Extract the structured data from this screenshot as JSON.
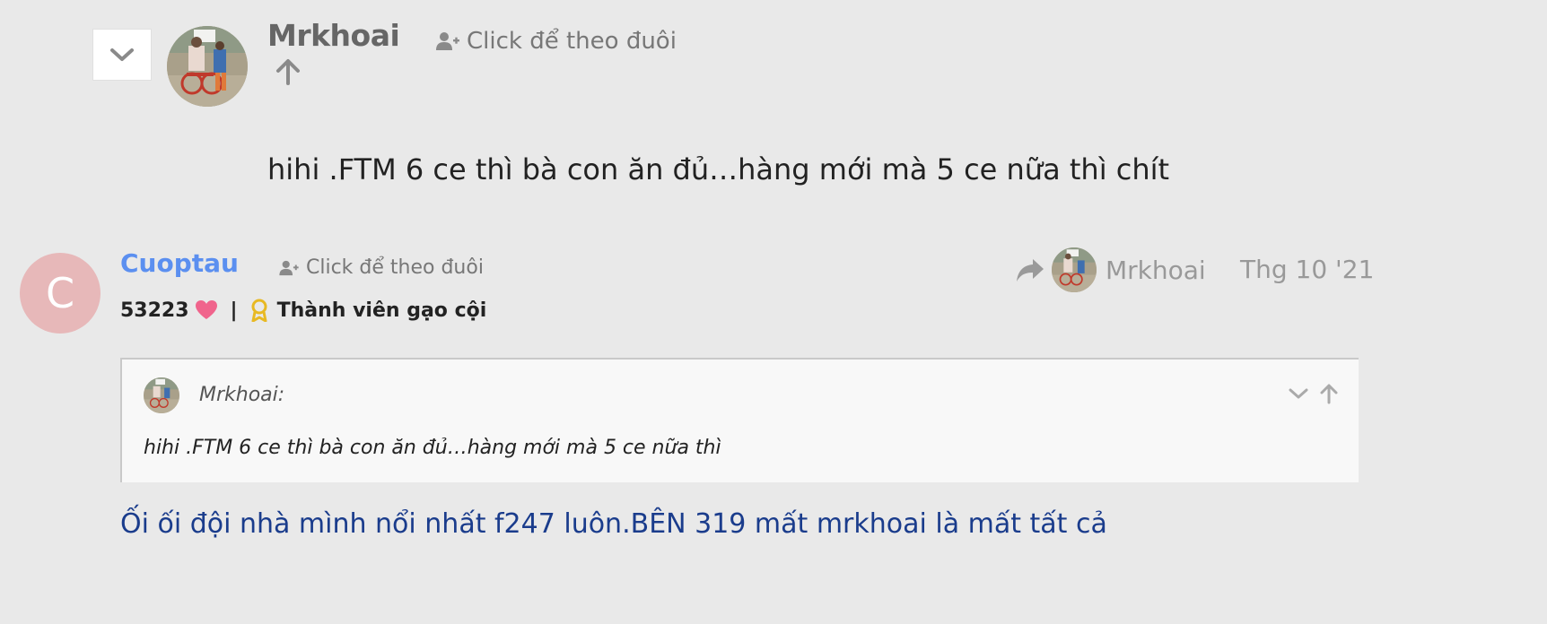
{
  "parent_post": {
    "author": "Mrkhoai",
    "follow_label": "Click để theo đuôi",
    "text": "hihi .FTM 6 ce thì bà con ăn đủ…hàng mới mà 5 ce nữa thì chít"
  },
  "reply": {
    "avatar_letter": "C",
    "avatar_color": "#e7b8b9",
    "author": "Cuoptau",
    "author_color": "#5b8ff0",
    "follow_label": "Click để theo đuôi",
    "points": "53223",
    "separator": "|",
    "rank": "Thành viên gạo cội",
    "reply_to": "Mrkhoai",
    "timestamp": "Thg 10 '21",
    "quote": {
      "author": "Mrkhoai:",
      "text": "hihi .FTM 6 ce thì bà con ăn đủ…hàng mới mà 5 ce nữa thì"
    },
    "text": "Ối ối đội nhà mình nổi nhất f247 luôn.BÊN 319 mất mrkhoai là mất tất cả",
    "text_color": "#1a3c8c"
  },
  "icons": {
    "collapse": "chevron-down-icon",
    "upvote": "arrow-up-icon",
    "follow": "user-plus-icon",
    "heart": "heart-icon",
    "rank": "award-icon",
    "reply_to": "share-arrow-icon"
  },
  "colors": {
    "background": "#e9e9e9",
    "heart": "#f0648c",
    "award": "#e8b923",
    "muted": "#999999"
  }
}
